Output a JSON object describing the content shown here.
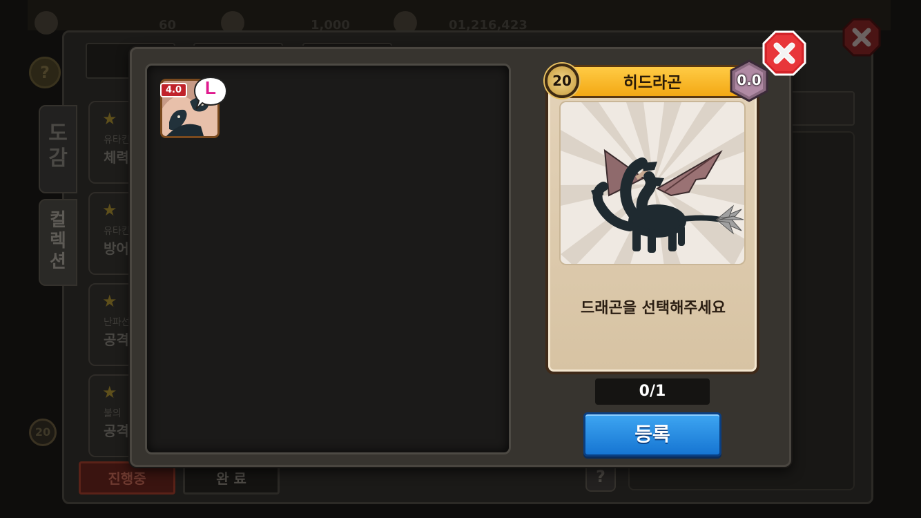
{
  "background": {
    "topbar_values": [
      "60",
      "1,000",
      "01,216,423"
    ],
    "side_tabs": [
      {
        "label": "도감",
        "active": false
      },
      {
        "label": "컬렉션",
        "active": true
      }
    ],
    "quests": [
      {
        "sub": "유타킨",
        "main": "체력"
      },
      {
        "sub": "유타킨",
        "main": "방어"
      },
      {
        "sub": "난파선",
        "main": "공격"
      },
      {
        "sub": "불의 ",
        "main": "공격"
      }
    ],
    "bottom_tabs": {
      "in_progress": "진행중",
      "completed": "완 료"
    },
    "help_glyph": "?",
    "badge_level": "20"
  },
  "slot": {
    "score": "4.0",
    "grade": "L"
  },
  "card": {
    "level": "20",
    "name": "히드라곤",
    "rating": "0.0",
    "message": "드래곤을 선택해주세요"
  },
  "counter": "0/1",
  "register_label": "등록",
  "close_glyph": "✖",
  "colors": {
    "banner": "#f3a814",
    "register": "#1675d2",
    "close": "#d3242a",
    "grade": "#e01b8f"
  },
  "icons": [
    "close-icon",
    "star-icon",
    "help-icon",
    "hydragon-dragon-art"
  ]
}
